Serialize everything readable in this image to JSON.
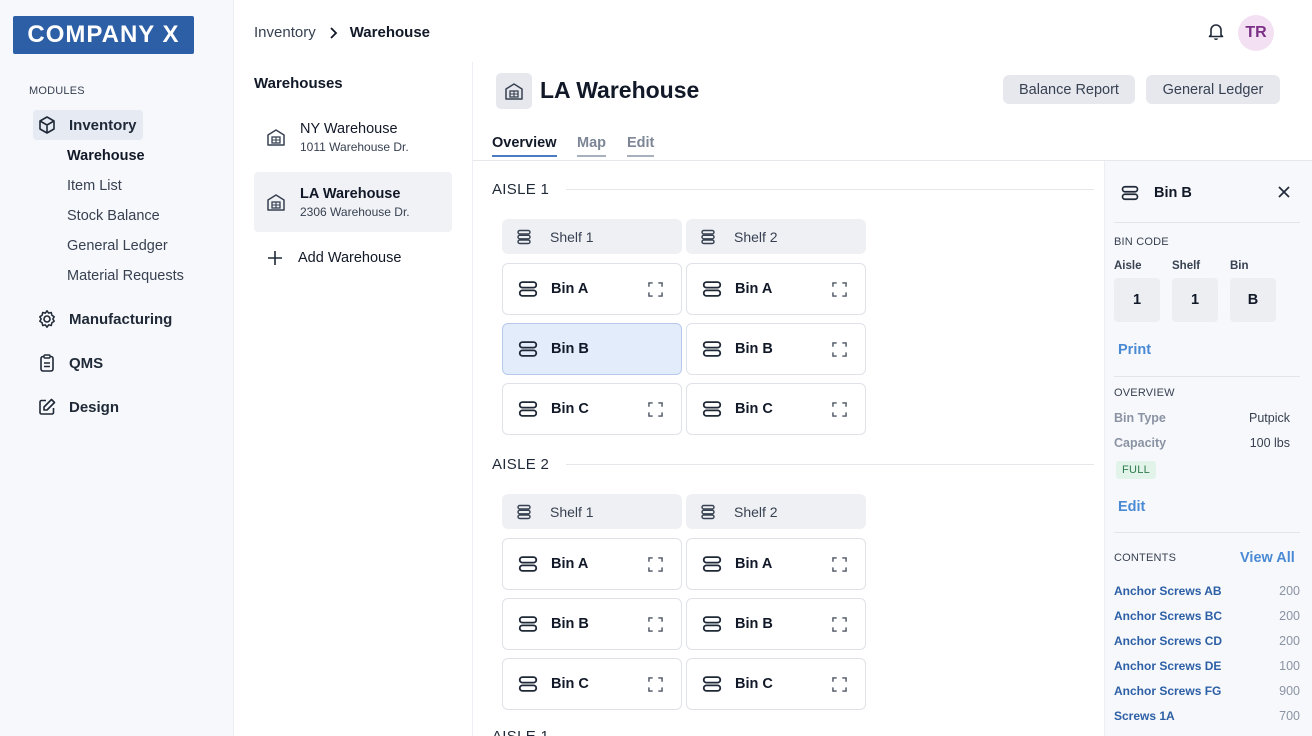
{
  "logo": "COMPANY X",
  "sidebar": {
    "section_label": "MODULES",
    "modules": [
      {
        "label": "Inventory",
        "icon": "cube-icon"
      },
      {
        "label": "Manufacturing",
        "icon": "gear-icon"
      },
      {
        "label": "QMS",
        "icon": "clipboard-icon"
      },
      {
        "label": "Design",
        "icon": "edit-square-icon"
      }
    ],
    "inventory_sub": [
      "Warehouse",
      "Item List",
      "Stock Balance",
      "General Ledger",
      "Material Requests"
    ]
  },
  "breadcrumb": {
    "parent": "Inventory",
    "current": "Warehouse"
  },
  "user": {
    "initials": "TR"
  },
  "warehouses": {
    "title": "Warehouses",
    "items": [
      {
        "name": "NY Warehouse",
        "address": "1011 Warehouse Dr."
      },
      {
        "name": "LA Warehouse",
        "address": "2306 Warehouse Dr."
      }
    ],
    "add_label": "Add Warehouse"
  },
  "main": {
    "title": "LA Warehouse",
    "buttons": {
      "balance": "Balance Report",
      "ledger": "General Ledger"
    },
    "tabs": [
      "Overview",
      "Map",
      "Edit"
    ],
    "aisles": [
      {
        "label": "AISLE 1",
        "shelves": [
          "Shelf 1",
          "Shelf 2"
        ],
        "bins": [
          "Bin A",
          "Bin B",
          "Bin C"
        ]
      },
      {
        "label": "AISLE 2",
        "shelves": [
          "Shelf 1",
          "Shelf 2"
        ],
        "bins": [
          "Bin A",
          "Bin B",
          "Bin C"
        ]
      }
    ],
    "next_aisle_label": "AISLE 1"
  },
  "panel": {
    "title": "Bin B",
    "bin_code_label": "BIN CODE",
    "code": [
      {
        "label": "Aisle",
        "value": "1"
      },
      {
        "label": "Shelf",
        "value": "1"
      },
      {
        "label": "Bin",
        "value": "B"
      }
    ],
    "print_label": "Print",
    "overview_label": "OVERVIEW",
    "bin_type_label": "Bin Type",
    "bin_type_value": "Putpick",
    "capacity_label": "Capacity",
    "capacity_value": "100 lbs",
    "status_badge": "FULL",
    "edit_label": "Edit",
    "contents_label": "CONTENTS",
    "view_all_label": "View All",
    "contents": [
      {
        "name": "Anchor Screws AB",
        "qty": "200"
      },
      {
        "name": "Anchor Screws BC",
        "qty": "200"
      },
      {
        "name": "Anchor Screws CD",
        "qty": "200"
      },
      {
        "name": "Anchor Screws DE",
        "qty": "100"
      },
      {
        "name": "Anchor Screws FG",
        "qty": "900"
      },
      {
        "name": "Screws 1A",
        "qty": "700"
      }
    ]
  },
  "colors": {
    "brand": "#2c5fa6",
    "selected_bin": "#e3ecfb",
    "link": "#4a8ad4",
    "badge_bg": "#e2f4ea",
    "badge_text": "#2f7a4c"
  }
}
